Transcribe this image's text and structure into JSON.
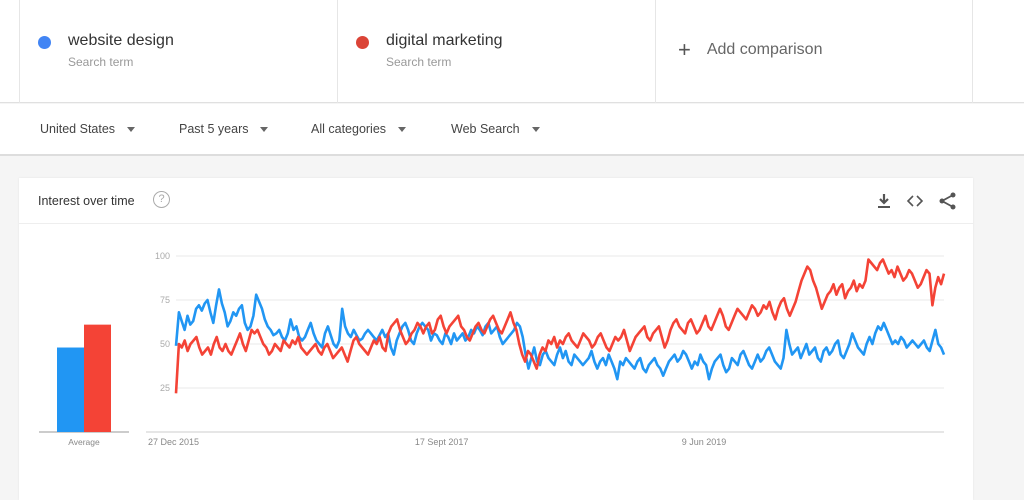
{
  "terms": [
    {
      "name": "website design",
      "sub": "Search term",
      "color": "#4285f4"
    },
    {
      "name": "digital marketing",
      "sub": "Search term",
      "color": "#db4437"
    }
  ],
  "add_comparison": "Add comparison",
  "filters": {
    "region": "United States",
    "time": "Past 5 years",
    "category": "All categories",
    "search_type": "Web Search"
  },
  "card": {
    "title": "Interest over time",
    "help_glyph": "?",
    "icons": [
      "download-icon",
      "embed-icon",
      "share-icon"
    ]
  },
  "chart_data": {
    "type": "line",
    "title": "Interest over time",
    "xlabel": "",
    "ylabel": "",
    "ylim": [
      0,
      100
    ],
    "yticks": [
      25,
      50,
      75,
      100
    ],
    "grid": true,
    "x_tick_labels": [
      "27 Dec 2015",
      "17 Sept 2017",
      "9 Jun 2019"
    ],
    "x_tick_week_index": [
      0,
      90,
      180
    ],
    "x_range_weeks": [
      0,
      259
    ],
    "average_bar": {
      "label": "Average",
      "values": [
        {
          "name": "website design",
          "value": 48
        },
        {
          "name": "digital marketing",
          "value": 61
        }
      ]
    },
    "series": [
      {
        "name": "website design",
        "color": "#2196f3",
        "values": [
          49,
          68,
          63,
          58,
          66,
          61,
          63,
          70,
          72,
          69,
          73,
          75,
          68,
          62,
          72,
          81,
          73,
          68,
          60,
          63,
          68,
          66,
          70,
          72,
          62,
          58,
          60,
          66,
          78,
          74,
          70,
          64,
          60,
          58,
          55,
          56,
          58,
          54,
          52,
          56,
          64,
          58,
          60,
          54,
          52,
          54,
          58,
          62,
          56,
          52,
          50,
          48,
          56,
          60,
          55,
          50,
          48,
          52,
          70,
          60,
          56,
          54,
          58,
          55,
          52,
          53,
          56,
          58,
          56,
          54,
          52,
          55,
          58,
          54,
          56,
          48,
          44,
          52,
          56,
          60,
          62,
          58,
          52,
          50,
          56,
          60,
          62,
          60,
          58,
          52,
          56,
          55,
          52,
          50,
          56,
          54,
          50,
          56,
          52,
          54,
          56,
          52,
          54,
          58,
          56,
          60,
          58,
          55,
          60,
          62,
          56,
          58,
          60,
          54,
          50,
          52,
          54,
          56,
          58,
          62,
          60,
          54,
          44,
          36,
          42,
          48,
          40,
          38,
          44,
          46,
          42,
          40,
          38,
          44,
          48,
          42,
          46,
          40,
          38,
          44,
          42,
          40,
          38,
          40,
          42,
          46,
          40,
          36,
          40,
          42,
          38,
          44,
          40,
          36,
          30,
          40,
          38,
          42,
          40,
          38,
          36,
          40,
          42,
          36,
          34,
          38,
          40,
          42,
          38,
          36,
          32,
          36,
          40,
          42,
          44,
          40,
          42,
          46,
          44,
          40,
          36,
          40,
          38,
          44,
          40,
          38,
          30,
          36,
          40,
          42,
          44,
          38,
          34,
          36,
          42,
          40,
          38,
          44,
          46,
          42,
          38,
          36,
          40,
          44,
          40,
          42,
          46,
          48,
          44,
          40,
          38,
          36,
          42,
          58,
          50,
          44,
          46,
          48,
          42,
          46,
          50,
          44,
          46,
          48,
          42,
          40,
          46,
          48,
          44,
          46,
          50,
          52,
          44,
          42,
          46,
          50,
          56,
          52,
          48,
          46,
          44,
          50,
          54,
          50,
          56,
          60,
          58,
          62,
          58,
          54,
          50,
          52,
          50,
          54,
          52,
          48,
          50,
          52,
          50,
          48,
          50,
          52,
          48,
          46,
          52,
          58,
          50,
          48,
          44
        ]
      },
      {
        "name": "digital marketing",
        "color": "#f44336",
        "values": [
          22,
          50,
          48,
          52,
          46,
          50,
          52,
          54,
          48,
          44,
          46,
          48,
          44,
          50,
          54,
          48,
          46,
          50,
          46,
          44,
          48,
          52,
          56,
          50,
          46,
          52,
          58,
          56,
          58,
          54,
          50,
          48,
          44,
          46,
          50,
          48,
          46,
          52,
          50,
          48,
          52,
          50,
          54,
          48,
          46,
          44,
          46,
          48,
          50,
          46,
          44,
          48,
          50,
          46,
          42,
          44,
          46,
          48,
          44,
          40,
          46,
          52,
          54,
          50,
          48,
          46,
          44,
          48,
          52,
          50,
          54,
          48,
          46,
          56,
          60,
          62,
          64,
          58,
          54,
          50,
          52,
          56,
          58,
          62,
          60,
          56,
          60,
          62,
          56,
          58,
          64,
          66,
          60,
          56,
          60,
          62,
          64,
          66,
          60,
          58,
          54,
          52,
          56,
          60,
          62,
          58,
          56,
          60,
          64,
          66,
          62,
          58,
          56,
          60,
          64,
          68,
          62,
          58,
          50,
          44,
          40,
          46,
          44,
          40,
          36,
          44,
          48,
          46,
          52,
          50,
          54,
          48,
          52,
          50,
          54,
          56,
          52,
          50,
          48,
          52,
          56,
          54,
          52,
          48,
          50,
          54,
          56,
          52,
          48,
          46,
          50,
          54,
          52,
          54,
          58,
          52,
          46,
          50,
          54,
          56,
          58,
          60,
          54,
          52,
          56,
          58,
          60,
          54,
          48,
          52,
          58,
          62,
          64,
          60,
          58,
          56,
          62,
          64,
          60,
          56,
          58,
          62,
          66,
          60,
          58,
          62,
          66,
          70,
          66,
          60,
          58,
          62,
          66,
          70,
          68,
          66,
          64,
          68,
          72,
          70,
          66,
          68,
          72,
          70,
          74,
          68,
          64,
          70,
          74,
          76,
          70,
          66,
          70,
          74,
          80,
          86,
          90,
          94,
          92,
          86,
          82,
          76,
          70,
          74,
          78,
          80,
          84,
          78,
          82,
          84,
          76,
          80,
          82,
          86,
          80,
          84,
          82,
          86,
          98,
          96,
          94,
          92,
          96,
          98,
          94,
          90,
          92,
          88,
          94,
          90,
          86,
          88,
          92,
          90,
          86,
          82,
          84,
          88,
          92,
          90,
          72,
          82,
          88,
          84,
          90
        ]
      }
    ]
  }
}
